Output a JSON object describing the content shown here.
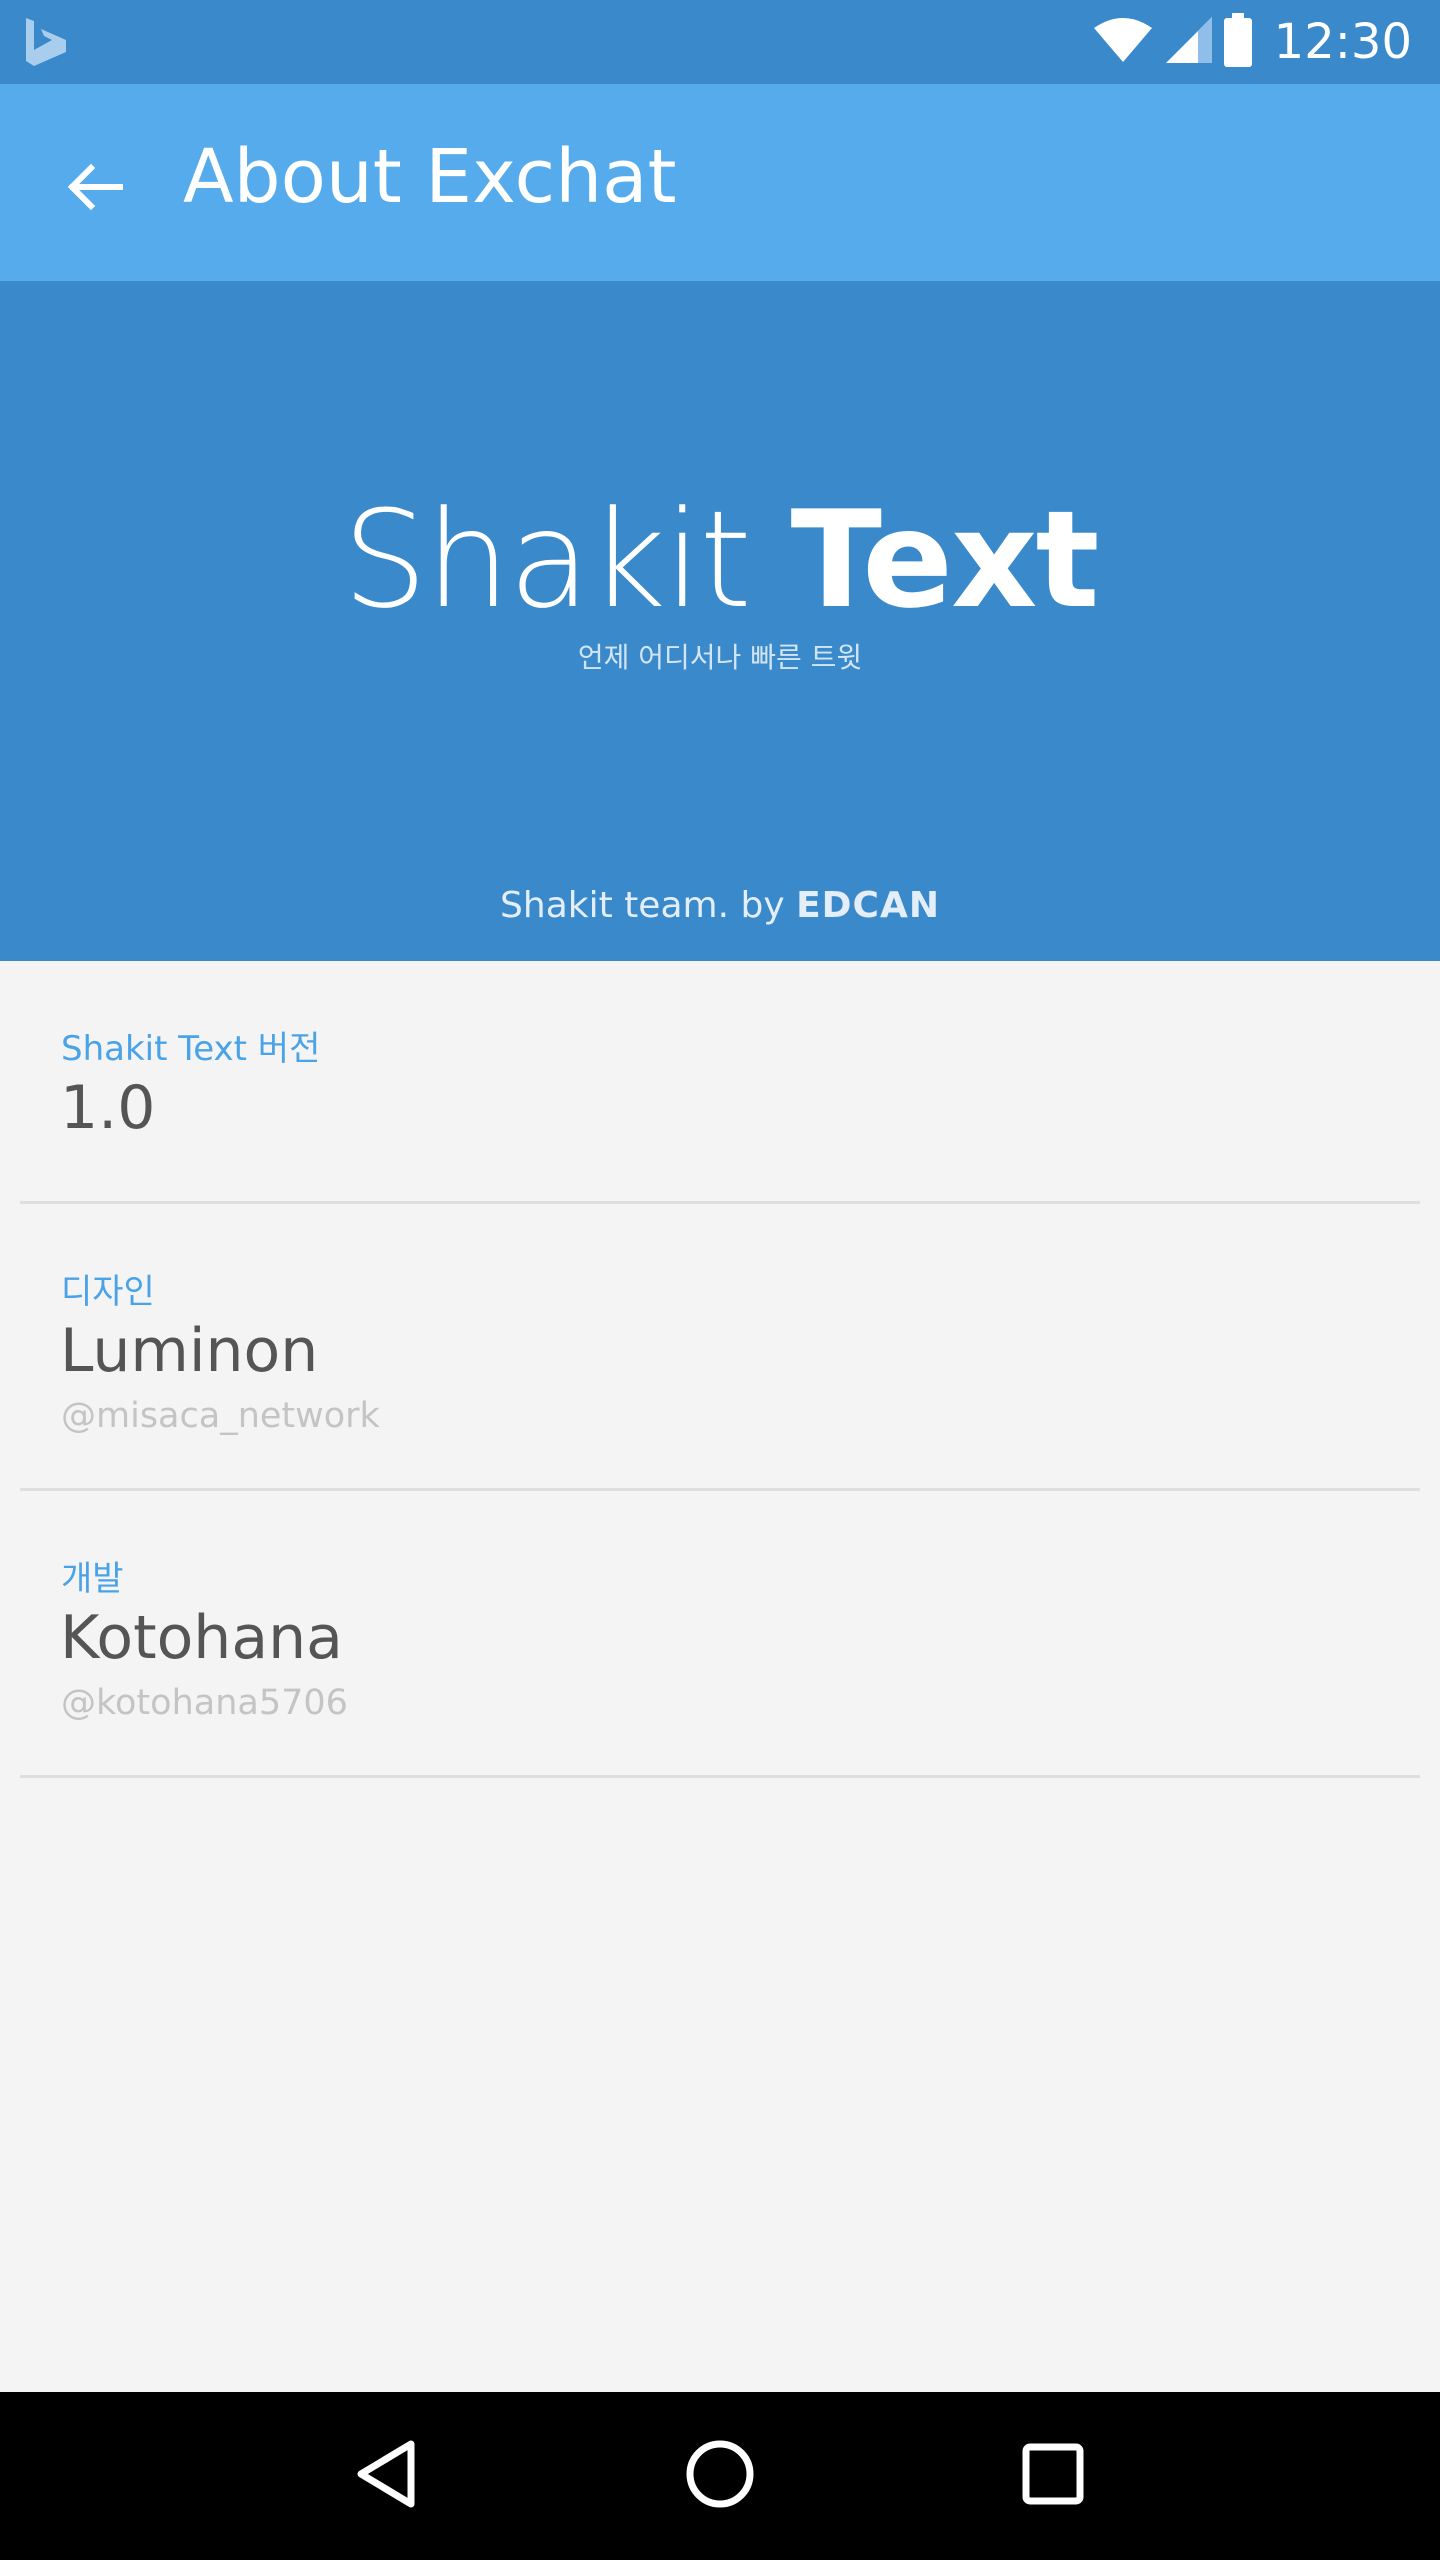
{
  "status_bar": {
    "time": "12:30",
    "icons": [
      "bing-icon",
      "wifi-icon",
      "signal-icon",
      "battery-icon"
    ]
  },
  "app_bar": {
    "title": "About Exchat",
    "back_icon": "arrow-back-icon"
  },
  "hero": {
    "title_light": "Shakit ",
    "title_bold": "Text",
    "tagline": "언제 어디서나 빠른 트윗",
    "footer_prefix": "Shakit team. by ",
    "footer_brand": "EDCAN"
  },
  "info": {
    "version": {
      "label": "Shakit Text 버전",
      "value": "1.0"
    },
    "design": {
      "label": "디자인",
      "value": "Luminon",
      "handle": "@misaca_network"
    },
    "development": {
      "label": "개발",
      "value": "Kotohana",
      "handle": "@kotohana5706"
    }
  },
  "nav_bar": {
    "icons": [
      "back-triangle-icon",
      "home-circle-icon",
      "recents-square-icon"
    ]
  },
  "colors": {
    "status_bar": "#3a8acb",
    "app_bar": "#55abec",
    "hero": "#3a8acb",
    "accent_label": "#4aa3e6",
    "value_text": "#555555",
    "handle_text": "#c4c4c4",
    "background": "#f4f4f4",
    "nav_bar": "#000000"
  }
}
